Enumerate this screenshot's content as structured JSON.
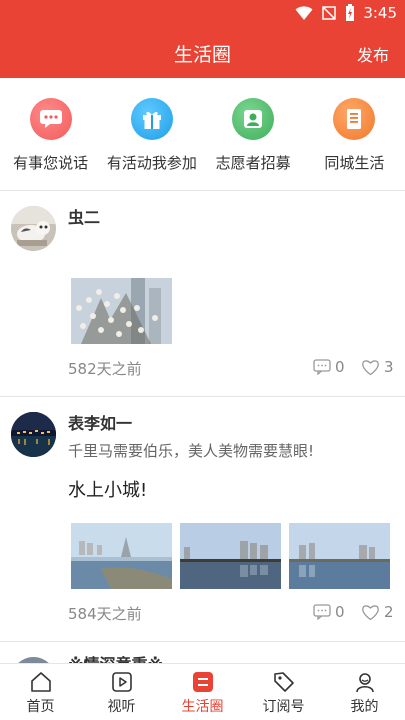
{
  "status_bar": {
    "time": "3:45"
  },
  "header": {
    "title": "生活圈",
    "action_label": "发布"
  },
  "categories": [
    {
      "label": "有事您说话",
      "icon": "chat-bubble-icon",
      "color": "#f25b5b"
    },
    {
      "label": "有活动我参加",
      "icon": "gift-icon",
      "color": "#27a8f0"
    },
    {
      "label": "志愿者招募",
      "icon": "person-icon",
      "color": "#4ab86a"
    },
    {
      "label": "同城生活",
      "icon": "document-icon",
      "color": "#f6843a"
    }
  ],
  "posts": [
    {
      "author": "虫二",
      "subtitle": "",
      "content": "",
      "time": "582天之前",
      "comments": "0",
      "likes": "3"
    },
    {
      "author": "表李如一",
      "subtitle": "千里马需要伯乐，美人美物需要慧眼!",
      "content": "水上小城!",
      "time": "584天之前",
      "comments": "0",
      "likes": "2"
    },
    {
      "author": "※情深意重※"
    }
  ],
  "bottom_nav": [
    {
      "label": "首页",
      "icon": "home-icon"
    },
    {
      "label": "视听",
      "icon": "play-icon"
    },
    {
      "label": "生活圈",
      "icon": "life-circle-icon",
      "active": true
    },
    {
      "label": "订阅号",
      "icon": "tag-icon"
    },
    {
      "label": "我的",
      "icon": "user-icon"
    }
  ],
  "colors": {
    "brand": "#e94335",
    "active": "#e94335"
  }
}
